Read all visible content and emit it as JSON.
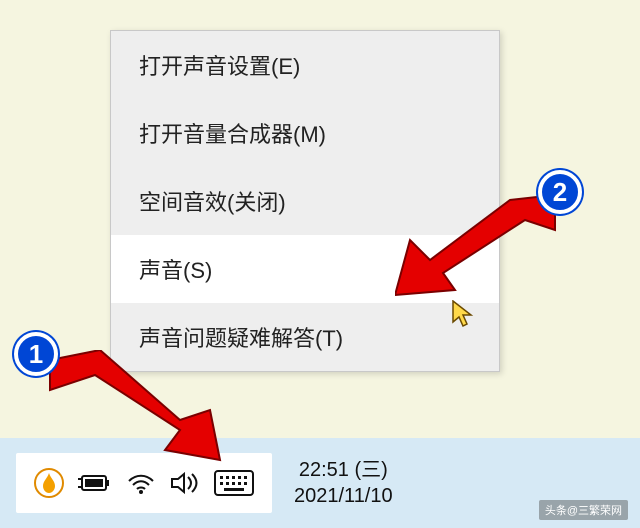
{
  "menu": {
    "items": [
      {
        "label": "打开声音设置(E)"
      },
      {
        "label": "打开音量合成器(M)"
      },
      {
        "label": "空间音效(关闭)"
      },
      {
        "label": "声音(S)"
      },
      {
        "label": "声音问题疑难解答(T)"
      }
    ],
    "highlight_index": 3
  },
  "taskbar": {
    "clock_time": "22:51 (三)",
    "clock_date": "2021/11/10"
  },
  "annotations": {
    "badge1": "1",
    "badge2": "2"
  },
  "watermark": "头条@三繁荣网"
}
